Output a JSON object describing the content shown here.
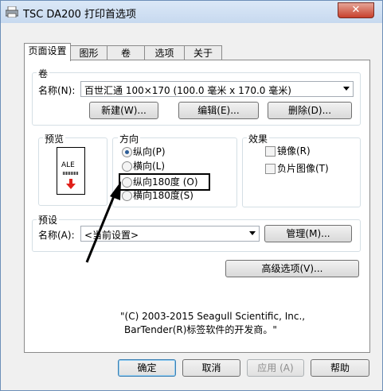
{
  "window": {
    "title": "TSC DA200 打印首选项",
    "close_label": "✕"
  },
  "tabs": [
    "页面设置",
    "图形",
    "卷",
    "选项",
    "关于"
  ],
  "roll": {
    "group_title": "卷",
    "name_label": "名称(N):",
    "name_value": "百世汇通 100×170 (100.0 毫米 x 170.0 毫米)",
    "new_button": "新建(W)...",
    "edit_button": "编辑(E)...",
    "delete_button": "删除(D)..."
  },
  "preview": {
    "group_title": "预览",
    "label_text": "ALE"
  },
  "orientation": {
    "group_title": "方向",
    "options": [
      "纵向(P)",
      "横向(L)",
      "纵向180度 (O)",
      "横向180度(S)"
    ],
    "selected": "纵向(P)"
  },
  "effects": {
    "group_title": "效果",
    "mirror": "镜像(R)",
    "negative": "负片图像(T)"
  },
  "preset": {
    "group_title": "预设",
    "name_label": "名称(A):",
    "name_value": "<当前设置>",
    "manage_button": "管理(M)..."
  },
  "advanced_button": "高级选项(V)...",
  "copyright": {
    "line1": "\"(C) 2003-2015 Seagull Scientific, Inc.,",
    "line2": "BarTender(R)标签软件的开发商。\""
  },
  "footer": {
    "ok": "确定",
    "cancel": "取消",
    "apply": "应用 (A)",
    "help": "帮助"
  },
  "colors": {
    "annotation": "#000000",
    "red_arrow": "#e0201a",
    "title_gradient": "#c7d9ef"
  }
}
